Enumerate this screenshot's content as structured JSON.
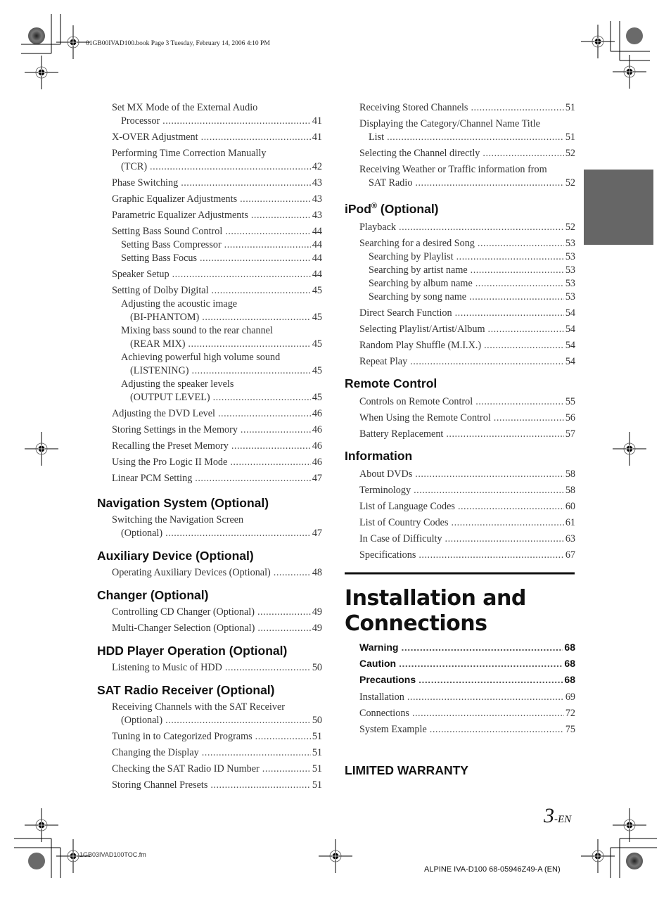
{
  "header": {
    "print_info": "01GB00IVAD100.book  Page 3  Tuesday, February 14, 2006  4:10 PM"
  },
  "left_column": {
    "continued_entries": [
      {
        "title": "Set MX Mode of the External Audio",
        "cont": "Processor",
        "page": "41",
        "level": 1
      },
      {
        "title": "X-OVER Adjustment",
        "page": "41",
        "level": 1
      },
      {
        "title": "Performing Time Correction Manually",
        "cont": "(TCR)",
        "page": "42",
        "level": 1
      },
      {
        "title": "Phase Switching",
        "page": "43",
        "level": 1
      },
      {
        "title": "Graphic Equalizer Adjustments",
        "page": "43",
        "level": 1
      },
      {
        "title": "Parametric Equalizer Adjustments",
        "page": "43",
        "level": 1
      },
      {
        "title": "Setting Bass Sound Control",
        "page": "44",
        "level": 1
      },
      {
        "title": "Setting Bass Compressor",
        "page": "44",
        "level": 2
      },
      {
        "title": "Setting Bass Focus",
        "page": "44",
        "level": 2
      },
      {
        "title": "Speaker Setup",
        "page": "44",
        "level": 1
      },
      {
        "title": "Setting of Dolby Digital",
        "page": "45",
        "level": 1
      },
      {
        "title": "Adjusting the acoustic image",
        "cont": "(BI-PHANTOM)",
        "page": "45",
        "level": 2
      },
      {
        "title": "Mixing bass sound to the rear channel",
        "cont": "(REAR MIX)",
        "page": "45",
        "level": 2
      },
      {
        "title": "Achieving powerful high volume sound",
        "cont": "(LISTENING)",
        "page": "45",
        "level": 2
      },
      {
        "title": "Adjusting the speaker levels",
        "cont": "(OUTPUT LEVEL)",
        "page": "45",
        "level": 2
      },
      {
        "title": "Adjusting the DVD Level",
        "page": "46",
        "level": 1
      },
      {
        "title": "Storing Settings in the Memory",
        "page": "46",
        "level": 1
      },
      {
        "title": "Recalling the Preset Memory",
        "page": "46",
        "level": 1
      },
      {
        "title": "Using the Pro Logic II Mode",
        "page": "46",
        "level": 1
      },
      {
        "title": "Linear PCM Setting",
        "page": "47",
        "level": 1
      }
    ],
    "sections": [
      {
        "heading": "Navigation System (Optional)",
        "entries": [
          {
            "title": "Switching the Navigation Screen",
            "cont": "(Optional)",
            "page": "47"
          }
        ]
      },
      {
        "heading": "Auxiliary Device (Optional)",
        "entries": [
          {
            "title": "Operating Auxiliary Devices (Optional)",
            "page": "48"
          }
        ]
      },
      {
        "heading": "Changer (Optional)",
        "entries": [
          {
            "title": "Controlling CD Changer (Optional)",
            "page": "49"
          },
          {
            "title": "Multi-Changer Selection (Optional)",
            "page": "49"
          }
        ]
      },
      {
        "heading": "HDD Player Operation (Optional)",
        "entries": [
          {
            "title": "Listening to Music of HDD",
            "page": "50"
          }
        ]
      },
      {
        "heading": "SAT Radio Receiver (Optional)",
        "entries": [
          {
            "title": "Receiving Channels with the SAT Receiver",
            "cont": "(Optional)",
            "page": "50"
          },
          {
            "title": "Tuning in to Categorized Programs",
            "page": "51"
          },
          {
            "title": "Changing the Display",
            "page": "51"
          },
          {
            "title": "Checking the SAT Radio ID Number",
            "page": "51"
          },
          {
            "title": "Storing Channel Presets",
            "page": "51"
          }
        ]
      }
    ]
  },
  "right_column": {
    "continued_entries": [
      {
        "title": "Receiving Stored Channels",
        "page": "51",
        "level": 1
      },
      {
        "title": "Displaying the Category/Channel Name Title",
        "cont": "List",
        "page": "51",
        "level": 1
      },
      {
        "title": "Selecting the Channel directly",
        "page": "52",
        "level": 1
      },
      {
        "title": "Receiving Weather or Traffic information from",
        "cont": "SAT Radio",
        "page": "52",
        "level": 1
      }
    ],
    "sections": [
      {
        "heading": "iPod",
        "heading_sup": "®",
        "heading_suffix": " (Optional)",
        "entries": [
          {
            "title": "Playback",
            "page": "52",
            "level": 1
          },
          {
            "title": "Searching for a desired Song",
            "page": "53",
            "level": 1
          },
          {
            "title": "Searching by Playlist",
            "page": "53",
            "level": 2
          },
          {
            "title": "Searching by artist name",
            "page": "53",
            "level": 2
          },
          {
            "title": "Searching by album name",
            "page": "53",
            "level": 2
          },
          {
            "title": "Searching by song name",
            "page": "53",
            "level": 2
          },
          {
            "title": "Direct Search Function",
            "page": "54",
            "level": 1
          },
          {
            "title": "Selecting Playlist/Artist/Album",
            "page": "54",
            "level": 1
          },
          {
            "title": "Random Play Shuffle (M.I.X.)",
            "page": "54",
            "level": 1
          },
          {
            "title": "Repeat Play",
            "page": "54",
            "level": 1
          }
        ]
      },
      {
        "heading": "Remote Control",
        "entries": [
          {
            "title": "Controls on Remote Control",
            "page": "55",
            "level": 1
          },
          {
            "title": "When Using the Remote Control",
            "page": "56",
            "level": 1
          },
          {
            "title": "Battery Replacement",
            "page": "57",
            "level": 1
          }
        ]
      },
      {
        "heading": "Information",
        "entries": [
          {
            "title": "About DVDs",
            "page": "58",
            "level": 1
          },
          {
            "title": "Terminology",
            "page": "58",
            "level": 1
          },
          {
            "title": "List of Language Codes",
            "page": "60",
            "level": 1
          },
          {
            "title": "List of Country Codes",
            "page": "61",
            "level": 1
          },
          {
            "title": "In Case of Difficulty",
            "page": "63",
            "level": 1
          },
          {
            "title": "Specifications",
            "page": "67",
            "level": 1
          }
        ]
      }
    ],
    "chapter": {
      "title_line1": "Installation and",
      "title_line2": "Connections",
      "bold_entries": [
        {
          "title": "Warning",
          "page": "68"
        },
        {
          "title": "Caution",
          "page": "68"
        },
        {
          "title": "Precautions",
          "page": "68"
        }
      ],
      "entries": [
        {
          "title": "Installation",
          "page": "69"
        },
        {
          "title": "Connections",
          "page": "72"
        },
        {
          "title": "System Example",
          "page": "75"
        }
      ]
    },
    "warranty_heading": "LIMITED WARRANTY"
  },
  "footer": {
    "page_number": "3",
    "page_suffix": "-EN",
    "file_name": "1GB03IVAD100TOC.fm",
    "model_info": "ALPINE IVA-D100 68-05946Z49-A (EN)"
  },
  "colors": {
    "thumb_tab": "#666666",
    "text": "#222222"
  }
}
